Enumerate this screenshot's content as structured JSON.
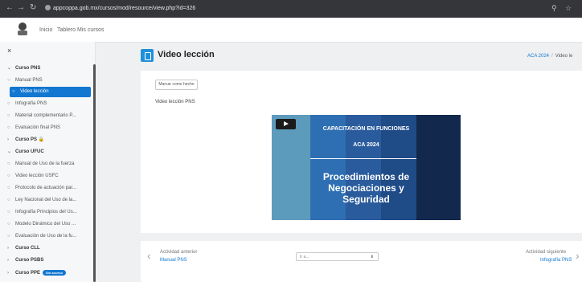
{
  "browser": {
    "url": "appcoppa.gob.mx/cursos/mod/resource/view.php?id=326",
    "back_icon": "arrow-left",
    "forward_icon": "arrow-right",
    "reload_icon": "reload",
    "site_info_icon": "site-info"
  },
  "topnav": {
    "items": [
      "Inicio",
      "Tablero",
      "Mis cursos"
    ]
  },
  "sidebar": {
    "close_icon": "×",
    "items": [
      {
        "icon": "⌄",
        "label": "Curso PNS"
      },
      {
        "icon": "○",
        "label": "Manual PNS"
      },
      {
        "icon": "○",
        "label": "Video lección"
      },
      {
        "icon": "○",
        "label": "Infografía PNS"
      },
      {
        "icon": "○",
        "label": "Material complementario P..."
      },
      {
        "icon": "○",
        "label": "Evaluación final PNS"
      },
      {
        "icon": "›",
        "label": "Curso PS 🔒"
      },
      {
        "icon": "⌄",
        "label": "Curso UFUC"
      },
      {
        "icon": "○",
        "label": "Manual de Uso de la fuerza"
      },
      {
        "icon": "○",
        "label": "Video lección USFC"
      },
      {
        "icon": "○",
        "label": "Protocolo de actuación par..."
      },
      {
        "icon": "○",
        "label": "Ley Nacional del Uso de la..."
      },
      {
        "icon": "○",
        "label": "Infografía Principios del Us..."
      },
      {
        "icon": "○",
        "label": "Modelo Dinámico del Uso ..."
      },
      {
        "icon": "○",
        "label": "Evaluación de Uso de la fu..."
      },
      {
        "icon": "›",
        "label": "Curso CLL"
      },
      {
        "icon": "›",
        "label": "Curso PSBS"
      },
      {
        "icon": "›",
        "label": "Curso PPE"
      }
    ],
    "badge": "Sin acceso"
  },
  "page": {
    "title": "Video lección",
    "breadcrumb": [
      "ACA 2024",
      "Video le"
    ]
  },
  "main": {
    "mark_done": "Marcar como hecho",
    "content_label": "Video lección PNS"
  },
  "video": {
    "line1": "CAPACITACIÓN EN FUNCIONES",
    "line2": "ACA 2024",
    "line3": "Procedimientos de",
    "line4": "Negociaciones y",
    "line5": "Seguridad"
  },
  "bottom": {
    "prev_label": "Actividad anterior",
    "prev_link": "Manual PNS",
    "jump_value": "Ir a...",
    "next_label": "Actividad siguiente",
    "next_link": "Infografía PNS"
  },
  "colors": {
    "accent": "#1177d1",
    "active_item": "#1177d1"
  }
}
